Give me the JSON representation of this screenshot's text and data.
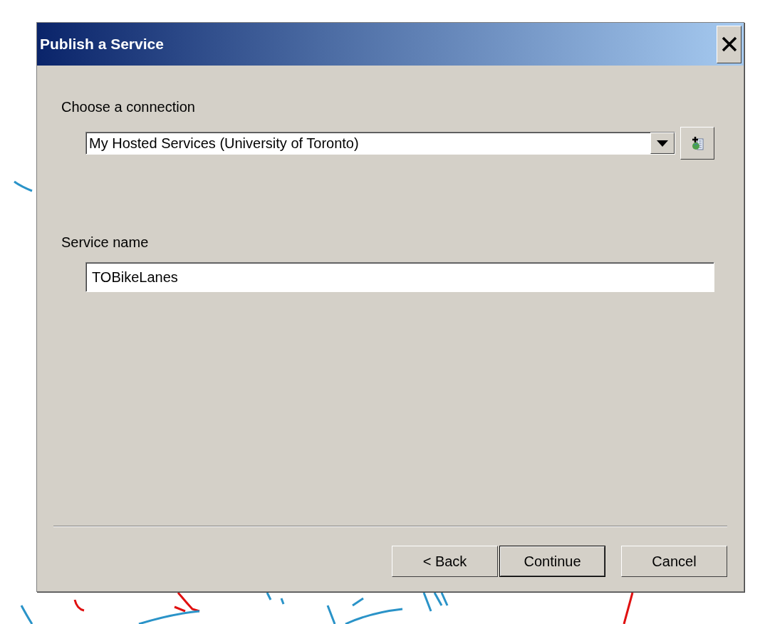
{
  "window": {
    "title": "Publish a Service"
  },
  "connection": {
    "label": "Choose a connection",
    "value": "My Hosted Services (University of Toronto)"
  },
  "service_name": {
    "label": "Service name",
    "value": "TOBikeLanes"
  },
  "buttons": [
    {
      "label": "< Back",
      "default": false
    },
    {
      "label": "Continue",
      "default": true
    },
    {
      "label": "Cancel",
      "default": false
    }
  ]
}
